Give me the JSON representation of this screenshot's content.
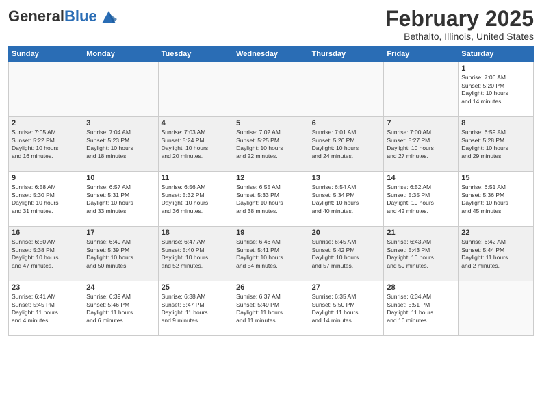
{
  "header": {
    "logo_general": "General",
    "logo_blue": "Blue",
    "month_title": "February 2025",
    "location": "Bethalto, Illinois, United States"
  },
  "days_of_week": [
    "Sunday",
    "Monday",
    "Tuesday",
    "Wednesday",
    "Thursday",
    "Friday",
    "Saturday"
  ],
  "weeks": [
    [
      {
        "day": "",
        "info": ""
      },
      {
        "day": "",
        "info": ""
      },
      {
        "day": "",
        "info": ""
      },
      {
        "day": "",
        "info": ""
      },
      {
        "day": "",
        "info": ""
      },
      {
        "day": "",
        "info": ""
      },
      {
        "day": "1",
        "info": "Sunrise: 7:06 AM\nSunset: 5:20 PM\nDaylight: 10 hours\nand 14 minutes."
      }
    ],
    [
      {
        "day": "2",
        "info": "Sunrise: 7:05 AM\nSunset: 5:22 PM\nDaylight: 10 hours\nand 16 minutes."
      },
      {
        "day": "3",
        "info": "Sunrise: 7:04 AM\nSunset: 5:23 PM\nDaylight: 10 hours\nand 18 minutes."
      },
      {
        "day": "4",
        "info": "Sunrise: 7:03 AM\nSunset: 5:24 PM\nDaylight: 10 hours\nand 20 minutes."
      },
      {
        "day": "5",
        "info": "Sunrise: 7:02 AM\nSunset: 5:25 PM\nDaylight: 10 hours\nand 22 minutes."
      },
      {
        "day": "6",
        "info": "Sunrise: 7:01 AM\nSunset: 5:26 PM\nDaylight: 10 hours\nand 24 minutes."
      },
      {
        "day": "7",
        "info": "Sunrise: 7:00 AM\nSunset: 5:27 PM\nDaylight: 10 hours\nand 27 minutes."
      },
      {
        "day": "8",
        "info": "Sunrise: 6:59 AM\nSunset: 5:28 PM\nDaylight: 10 hours\nand 29 minutes."
      }
    ],
    [
      {
        "day": "9",
        "info": "Sunrise: 6:58 AM\nSunset: 5:30 PM\nDaylight: 10 hours\nand 31 minutes."
      },
      {
        "day": "10",
        "info": "Sunrise: 6:57 AM\nSunset: 5:31 PM\nDaylight: 10 hours\nand 33 minutes."
      },
      {
        "day": "11",
        "info": "Sunrise: 6:56 AM\nSunset: 5:32 PM\nDaylight: 10 hours\nand 36 minutes."
      },
      {
        "day": "12",
        "info": "Sunrise: 6:55 AM\nSunset: 5:33 PM\nDaylight: 10 hours\nand 38 minutes."
      },
      {
        "day": "13",
        "info": "Sunrise: 6:54 AM\nSunset: 5:34 PM\nDaylight: 10 hours\nand 40 minutes."
      },
      {
        "day": "14",
        "info": "Sunrise: 6:52 AM\nSunset: 5:35 PM\nDaylight: 10 hours\nand 42 minutes."
      },
      {
        "day": "15",
        "info": "Sunrise: 6:51 AM\nSunset: 5:36 PM\nDaylight: 10 hours\nand 45 minutes."
      }
    ],
    [
      {
        "day": "16",
        "info": "Sunrise: 6:50 AM\nSunset: 5:38 PM\nDaylight: 10 hours\nand 47 minutes."
      },
      {
        "day": "17",
        "info": "Sunrise: 6:49 AM\nSunset: 5:39 PM\nDaylight: 10 hours\nand 50 minutes."
      },
      {
        "day": "18",
        "info": "Sunrise: 6:47 AM\nSunset: 5:40 PM\nDaylight: 10 hours\nand 52 minutes."
      },
      {
        "day": "19",
        "info": "Sunrise: 6:46 AM\nSunset: 5:41 PM\nDaylight: 10 hours\nand 54 minutes."
      },
      {
        "day": "20",
        "info": "Sunrise: 6:45 AM\nSunset: 5:42 PM\nDaylight: 10 hours\nand 57 minutes."
      },
      {
        "day": "21",
        "info": "Sunrise: 6:43 AM\nSunset: 5:43 PM\nDaylight: 10 hours\nand 59 minutes."
      },
      {
        "day": "22",
        "info": "Sunrise: 6:42 AM\nSunset: 5:44 PM\nDaylight: 11 hours\nand 2 minutes."
      }
    ],
    [
      {
        "day": "23",
        "info": "Sunrise: 6:41 AM\nSunset: 5:45 PM\nDaylight: 11 hours\nand 4 minutes."
      },
      {
        "day": "24",
        "info": "Sunrise: 6:39 AM\nSunset: 5:46 PM\nDaylight: 11 hours\nand 6 minutes."
      },
      {
        "day": "25",
        "info": "Sunrise: 6:38 AM\nSunset: 5:47 PM\nDaylight: 11 hours\nand 9 minutes."
      },
      {
        "day": "26",
        "info": "Sunrise: 6:37 AM\nSunset: 5:49 PM\nDaylight: 11 hours\nand 11 minutes."
      },
      {
        "day": "27",
        "info": "Sunrise: 6:35 AM\nSunset: 5:50 PM\nDaylight: 11 hours\nand 14 minutes."
      },
      {
        "day": "28",
        "info": "Sunrise: 6:34 AM\nSunset: 5:51 PM\nDaylight: 11 hours\nand 16 minutes."
      },
      {
        "day": "",
        "info": ""
      }
    ]
  ]
}
